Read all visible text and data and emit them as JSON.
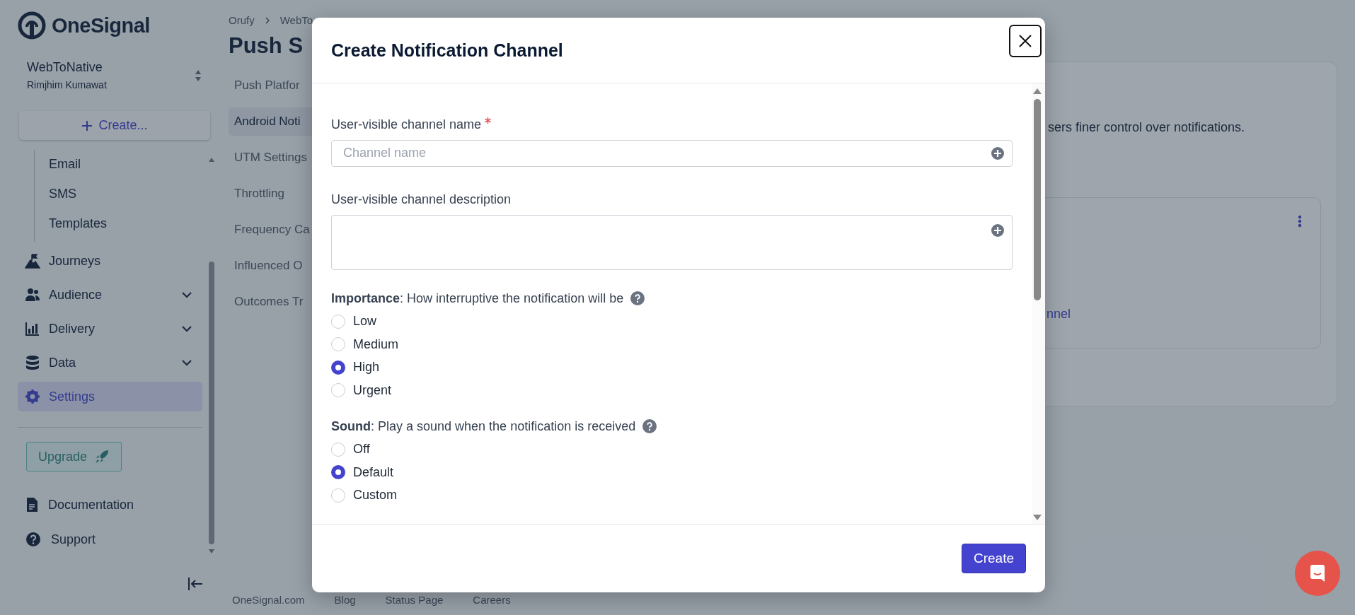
{
  "sidebar": {
    "brand": "OneSignal",
    "workspace": {
      "name": "WebToNative",
      "user": "Rimjhim Kumawat"
    },
    "create_button": "Create...",
    "sub_items": [
      "Email",
      "SMS",
      "Templates"
    ],
    "nav": [
      {
        "label": "Journeys",
        "expandable": false,
        "selected": false
      },
      {
        "label": "Audience",
        "expandable": true,
        "selected": false
      },
      {
        "label": "Delivery",
        "expandable": true,
        "selected": false
      },
      {
        "label": "Data",
        "expandable": true,
        "selected": false
      },
      {
        "label": "Settings",
        "expandable": false,
        "selected": true
      }
    ],
    "upgrade_button": "Upgrade",
    "links": [
      "Documentation",
      "Support"
    ]
  },
  "breadcrumb": [
    "Orufy",
    "WebTo"
  ],
  "page_title": "Push S",
  "subnav": [
    {
      "label": "Push Platfor",
      "selected": false
    },
    {
      "label": "Android Noti",
      "selected": true
    },
    {
      "label": "UTM Settings",
      "selected": false
    },
    {
      "label": "Throttling",
      "selected": false
    },
    {
      "label": "Frequency Ca",
      "selected": false
    },
    {
      "label": "Influenced O",
      "selected": false
    },
    {
      "label": "Outcomes Tr",
      "selected": false
    }
  ],
  "card": {
    "description": "sers finer control over notifications.",
    "link": "nnel"
  },
  "footer": [
    "OneSignal.com",
    "Blog",
    "Status Page",
    "Careers"
  ],
  "modal": {
    "title": "Create Notification Channel",
    "fields": [
      {
        "kind": "input",
        "label": "User-visible channel name",
        "required": true,
        "placeholder": "Channel name"
      },
      {
        "kind": "textarea",
        "label": "User-visible channel description",
        "required": false
      }
    ],
    "groups": [
      {
        "label": "**Importance**: How interruptive the notification will be",
        "options": [
          {
            "label": "Low",
            "selected": false
          },
          {
            "label": "Medium",
            "selected": false
          },
          {
            "label": "High",
            "selected": true
          },
          {
            "label": "Urgent",
            "selected": false
          }
        ]
      },
      {
        "label": "**Sound**: Play a sound when the notification is received",
        "options": [
          {
            "label": "Off",
            "selected": false
          },
          {
            "label": "Default",
            "selected": true
          },
          {
            "label": "Custom",
            "selected": false
          }
        ]
      }
    ],
    "submit_button": "Create"
  }
}
